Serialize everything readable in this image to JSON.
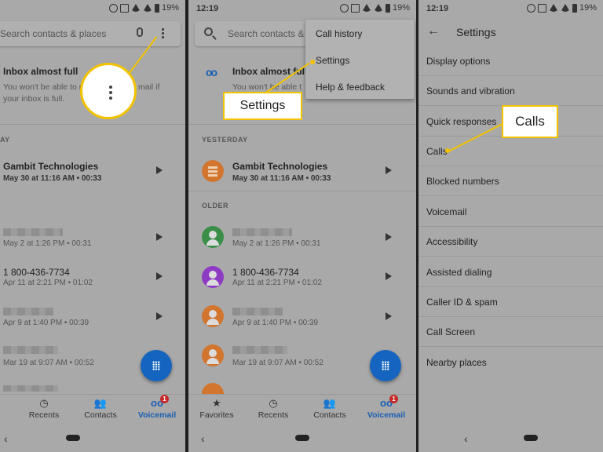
{
  "colors": {
    "accent": "#1a5fb4",
    "highlight": "#f2c300",
    "fab": "#1565c0",
    "badge": "#c62828"
  },
  "statusbar": {
    "time": "12:19",
    "battery": "19%"
  },
  "panel1": {
    "search_placeholder": "Search contacts & places",
    "inbox": {
      "title": "Inbox almost full",
      "desc_line1": "You won't be able to rec",
      "desc_line1b": "mail if",
      "desc_line2": "your inbox is full."
    },
    "section_today": "AY",
    "rows": [
      {
        "name": "Gambit Technologies",
        "meta": "May 30 at 11:16 AM • 00:33"
      },
      {
        "name": "",
        "meta": "May 2 at 1:26 PM • 00:31"
      },
      {
        "name": "1 800-436-7734",
        "meta": "Apr 11 at 2:21 PM • 01:02"
      },
      {
        "name": "",
        "meta": "Apr 9 at 1:40 PM • 00:39"
      },
      {
        "name": "",
        "meta": "Mar 19 at 9:07 AM • 00:52"
      }
    ],
    "nav": {
      "favorites": "s",
      "recents": "Recents",
      "contacts": "Contacts",
      "voicemail": "Voicemail",
      "badge": "1"
    }
  },
  "panel2": {
    "search_placeholder": "Search contacts & p",
    "menu": {
      "call_history": "Call history",
      "settings": "Settings",
      "help": "Help & feedback"
    },
    "callout": "Settings",
    "inbox": {
      "title": "Inbox almost full",
      "desc": "You won't be able t"
    },
    "section_yesterday": "YESTERDAY",
    "section_older": "OLDER",
    "rows": [
      {
        "name": "Gambit Technologies",
        "meta": "May 30 at 11:16 AM • 00:33"
      },
      {
        "name": "",
        "meta": "May 2 at 1:26 PM • 00:31"
      },
      {
        "name": "1 800-436-7734",
        "meta": "Apr 11 at 2:21 PM • 01:02"
      },
      {
        "name": "",
        "meta": "Apr 9 at 1:40 PM • 00:39"
      },
      {
        "name": "",
        "meta": "Mar 19 at 9:07 AM • 00:52"
      }
    ],
    "nav": {
      "favorites": "Favorites",
      "recents": "Recents",
      "contacts": "Contacts",
      "voicemail": "Voicemail",
      "badge": "1"
    }
  },
  "panel3": {
    "title": "Settings",
    "callout": "Calls",
    "items": [
      "Display options",
      "Sounds and vibration",
      "Quick responses",
      "Calls",
      "Blocked numbers",
      "Voicemail",
      "Accessibility",
      "Assisted dialing",
      "Caller ID & spam",
      "Call Screen",
      "Nearby places"
    ]
  }
}
